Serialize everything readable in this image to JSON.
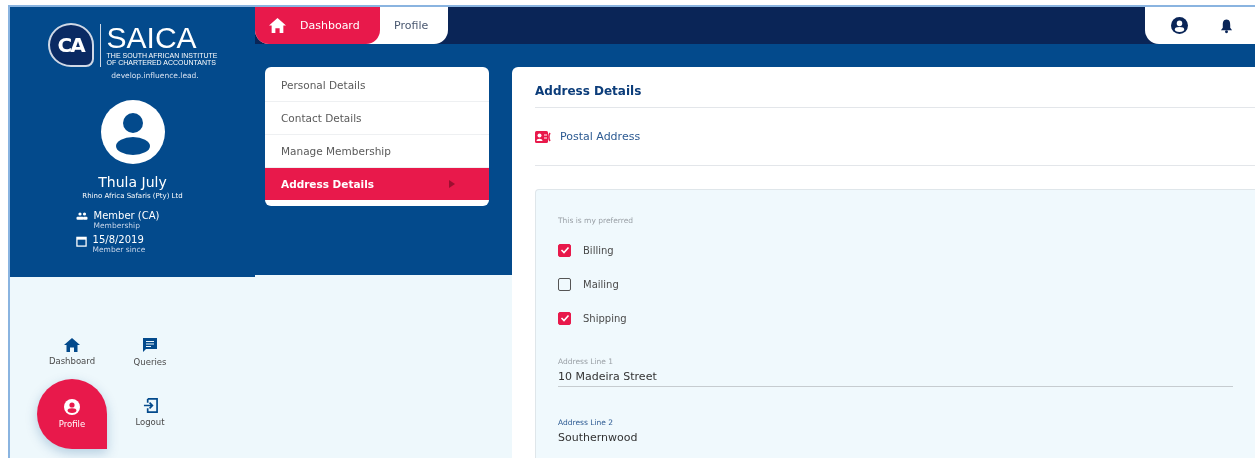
{
  "logo": {
    "mark": "CA",
    "name": "SAICA",
    "subtitle": [
      "THE SOUTH AFRICAN INSTITUTE",
      "OF CHARTERED ACCOUNTANTS"
    ],
    "tagline": "develop.influence.lead."
  },
  "user": {
    "name": "Thula July",
    "company": "Rhino Africa Safaris (Pty) Ltd",
    "details": [
      {
        "kind": "membership",
        "value": "Member (CA)",
        "caption": "Membership"
      },
      {
        "kind": "date",
        "value": "15/8/2019",
        "caption": "Member since"
      }
    ]
  },
  "side_nav": [
    {
      "kind": "home",
      "label": "Dashboard",
      "selected": false
    },
    {
      "kind": "queries",
      "label": "Queries",
      "selected": false
    },
    {
      "kind": "profile",
      "label": "Profile",
      "selected": true
    },
    {
      "kind": "logout",
      "label": "Logout",
      "selected": false
    }
  ],
  "top_tabs": [
    {
      "kind": "home",
      "label": "Dashboard",
      "selected": true
    },
    {
      "kind": "plain",
      "label": "Profile",
      "selected": false
    }
  ],
  "profile_menu": [
    {
      "label": "Personal Details",
      "selected": false
    },
    {
      "label": "Contact Details",
      "selected": false
    },
    {
      "label": "Manage Membership",
      "selected": false
    },
    {
      "label": "Address Details",
      "selected": true
    }
  ],
  "content": {
    "title": "Address Details",
    "section": "Postal Address",
    "preferred_label": "This is my preferred",
    "preferences": [
      {
        "label": "Billing",
        "checked": true
      },
      {
        "label": "Mailing",
        "checked": false
      },
      {
        "label": "Shipping",
        "checked": true
      }
    ],
    "fields": [
      {
        "label": "Address Line 1",
        "value": "10 Madeira Street",
        "focused": false
      },
      {
        "label": "Address Line 2",
        "value": "Southernwood",
        "focused": true
      }
    ]
  }
}
